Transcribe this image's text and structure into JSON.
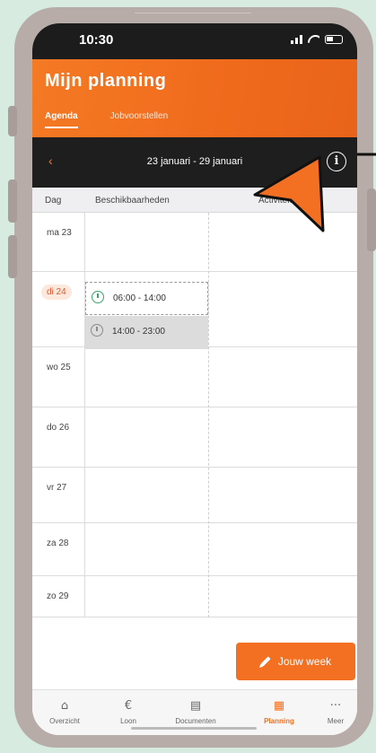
{
  "status_bar": {
    "time": "10:30"
  },
  "header": {
    "title": "Mijn planning",
    "tabs": [
      {
        "label": "Agenda",
        "active": true
      },
      {
        "label": "Jobvoorstellen",
        "active": false
      }
    ]
  },
  "week_nav": {
    "prev": "‹",
    "next": "›",
    "label": "23 januari - 29 januari",
    "info": "i"
  },
  "columns": {
    "day": "Dag",
    "availability": "Beschikbaarheden",
    "activities": "Activiteiten"
  },
  "days": [
    {
      "label": "ma 23"
    },
    {
      "label": "di 24",
      "today": true
    },
    {
      "label": "wo 25"
    },
    {
      "label": "do 26"
    },
    {
      "label": "vr 27"
    },
    {
      "label": "za 28"
    },
    {
      "label": "zo 29"
    }
  ],
  "slots": [
    {
      "day": "di 24",
      "time": "06:00 - 14:00",
      "status": "available"
    },
    {
      "day": "di 24",
      "time": "14:00 - 23:00",
      "status": "unavailable"
    }
  ],
  "week_button": {
    "label": "Jouw week"
  },
  "bottom_nav": [
    {
      "label": "Overzicht",
      "icon": "home-icon",
      "glyph": "⌂"
    },
    {
      "label": "Loon",
      "icon": "euro-icon",
      "glyph": "€"
    },
    {
      "label": "Documenten",
      "icon": "document-icon",
      "glyph": "▤"
    },
    {
      "label": "Planning",
      "icon": "calendar-icon",
      "glyph": "▦",
      "active": true
    },
    {
      "label": "Meer",
      "icon": "more-icon",
      "glyph": "···"
    }
  ],
  "colors": {
    "accent": "#f36f22",
    "header_dark": "#1f1e1e",
    "available": "#3aa46a"
  }
}
